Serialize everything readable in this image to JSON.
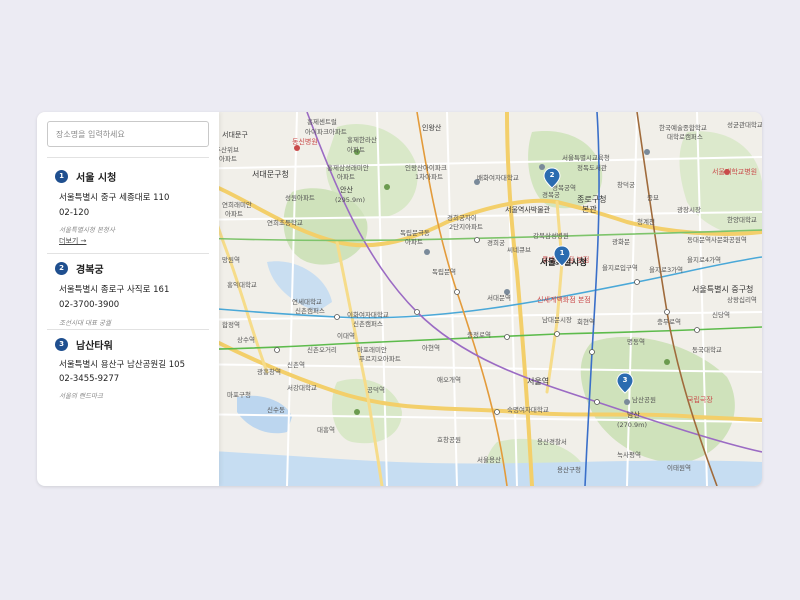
{
  "search": {
    "placeholder": "장소명을 입력하세요"
  },
  "places": [
    {
      "number": "1",
      "name": "서울 시청",
      "address": "서울특별시 중구 세종대로 110",
      "phone": "02-120",
      "description": "서울특별시청 본청사",
      "more_label": "더보기 →"
    },
    {
      "number": "2",
      "name": "경복궁",
      "address": "서울특별시 종로구 사직로 161",
      "phone": "02-3700-3900",
      "description": "조선시대 대표 궁궐"
    },
    {
      "number": "3",
      "name": "남산타워",
      "address": "서울특별시 용산구 남산공원길 105",
      "phone": "02-3455-9277",
      "description": "서울의 랜드마크"
    }
  ],
  "map": {
    "markers": [
      {
        "number": "1",
        "label": "서울특별시청"
      },
      {
        "number": "2",
        "label": "경복궁"
      },
      {
        "number": "3",
        "label": "남산공원"
      }
    ],
    "labels": {
      "hongje_central": "홍제센트럴",
      "apartment_hoban": "아이파크아파트",
      "seodaemun_gu": "서대문구",
      "dusan": "두산위브",
      "dusan_apt": "아파트",
      "dongsin_hospital": "동신병원",
      "seoul_si": "서울시",
      "hongje_hallasan": "홍제한라산",
      "apartment2": "아파트",
      "inwangsan": "인왕산",
      "samseong_raemian": "홍제삼성래미안",
      "apartment3": "아파트",
      "inwangsan_ipark": "인왕산아이파크",
      "ipark_1cha": "1차아파트",
      "seodaemun_office": "서대문구청",
      "ansan": "안산",
      "ansan_height": "(295.9m)",
      "seongwon_apt": "성원아파트",
      "yeonhui_raemian": "연희래미안",
      "apt_yeonhui": "아파트",
      "yeonhui_seobu": "연희초등학교",
      "dongnimmun_apt": "독립문극동",
      "dongnimmun_apt2": "아파트",
      "dongnimmun_station": "독립문역",
      "gyeonghuigung": "경희궁자이",
      "gyeonghui_2": "2단지아파트",
      "gyeonghuigung_palace": "경희궁",
      "gwanghwamun": "광화문",
      "seoul_museum": "서울역사박물관",
      "pai_chai": "배화여자대학교",
      "jongno_office": "종로구청",
      "jongno_bonggwan": "본관",
      "jongno_3ga": "종로3가역",
      "gwanghwamun_st": "광화문역",
      "gangbuk_samsung": "강북삼성병원",
      "seoul_cityhall_label": "서울특별시청",
      "gyeongbokgung_label": "경복궁",
      "gyeongbokgung_st": "경복궁역",
      "seoul_metro": "서울특별시교육청",
      "jeongdok": "정독도서관",
      "changdeok": "창덕궁",
      "hanguk_art": "한국예술종합학교",
      "daehak": "대학로캠퍼스",
      "seonggyun": "성균관대학교",
      "hyehwa": "혜화역",
      "seoul_univ_hospital": "서울대학교병원",
      "jongmyo": "종묘",
      "ewha_womans": "이화여자대학교",
      "ewha2": "신촌캠퍼스",
      "yonsei": "연세대학교",
      "yonsei2": "신촌캠퍼스",
      "sinchon_st": "신촌역",
      "ahyeon": "아현역",
      "chungjeongno": "충정로역",
      "seodaemun_st": "서대문역",
      "seoul_station": "서울역",
      "hoehyeon": "회현역",
      "myeongdong": "명동역",
      "chungmuro": "충무로역",
      "euljiro": "을지로입구역",
      "euljiro3": "을지로3가역",
      "euljiro4": "을지로4가역",
      "dongdaemun": "동대문역사문화공원역",
      "dongdaemun_design": "동대문디자인플라자",
      "jung_gu": "서울특별시 중구청",
      "shinsegae": "신세계백화점 본점",
      "lotte": "롯데백화점 본점",
      "namdaemun": "남대문시장",
      "sookmyung": "숙명여자대학교",
      "namsan": "남산",
      "namsan_height": "(270.9m)",
      "dongguk": "동국대학교",
      "gukrip": "국립극장",
      "hyochang": "효창공원",
      "mapo_office": "마포구청",
      "gongdeok": "공덕역",
      "aeogae": "애오개역",
      "mapo_raemian": "마포래미안",
      "mapo_apt": "푸르지오아파트",
      "seogang": "서강대학교",
      "sinsu": "신수동",
      "daeheung": "대흥역",
      "yongsan_office": "서울용산",
      "seoul_yongsan_police": "용산경찰서",
      "noksapyeong": "녹사평역",
      "itaewon": "이태원역",
      "yongsan_gu": "용산구청",
      "namsan_tower": "남산타워",
      "sindang": "신당역",
      "sangwangsimni": "상왕십리역",
      "hanyang": "한양대학교",
      "cheonggye": "청계천",
      "hongdae": "홍익대학교",
      "mangwon": "망원역",
      "hapjeong": "합정역",
      "sangsu": "상수역",
      "gwangheungchang": "광흥창역",
      "ewha_st": "이대역",
      "sinchon_rotary": "신촌오거리",
      "ssiel": "씨네큐브",
      "gwangjang": "광장시장"
    }
  }
}
